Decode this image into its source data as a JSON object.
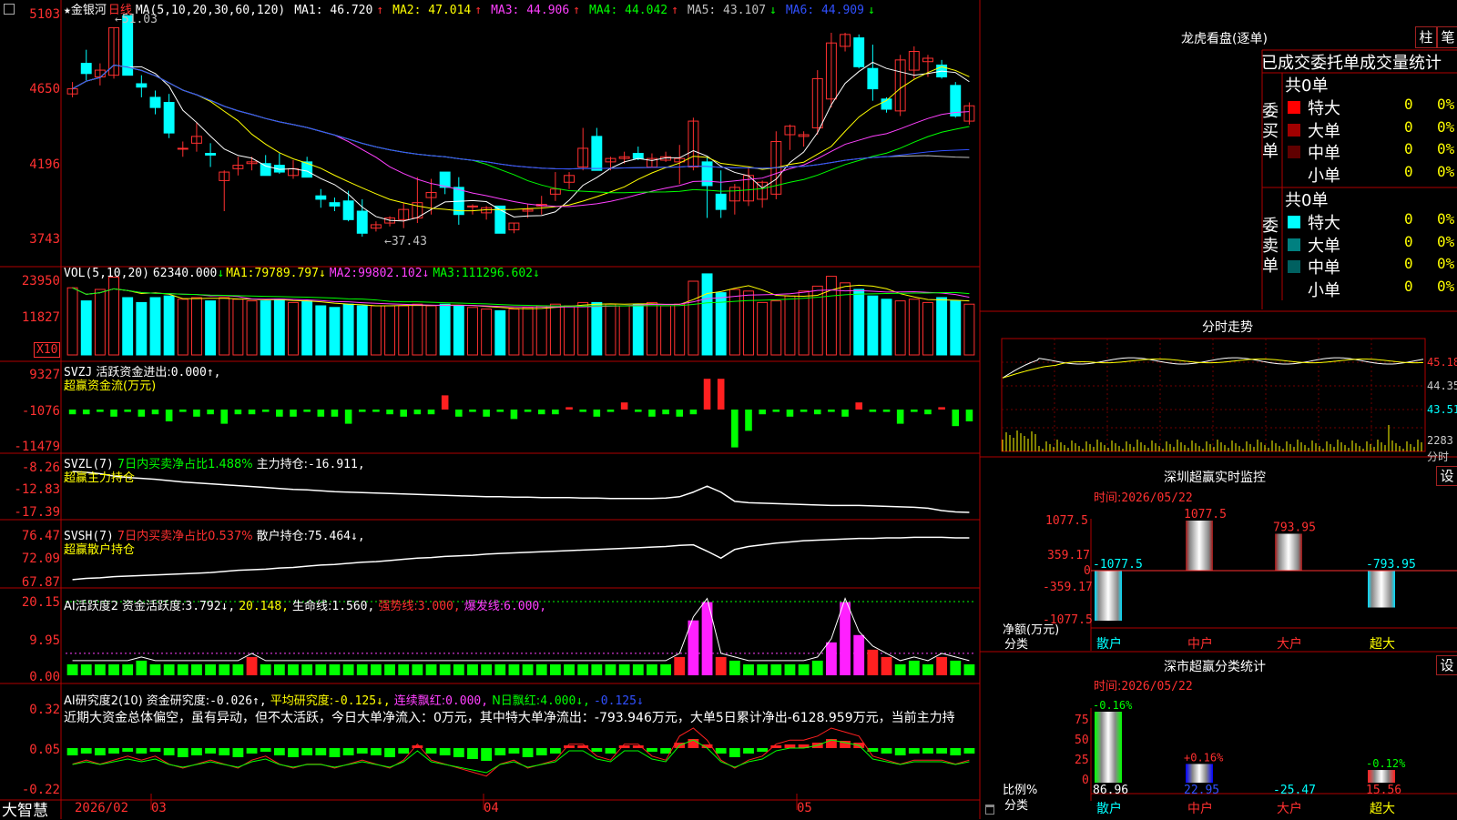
{
  "app": {
    "brand": "大智慧",
    "corner_icon": "restore-icon"
  },
  "main_chart": {
    "star_symbol": "★",
    "stock_name": "金银河",
    "period": "日线",
    "ma_params": "MA(5,10,20,30,60,120)",
    "ma": [
      {
        "label": "MA1:",
        "value": "46.720",
        "arrow": "↑",
        "color": "#ffffff"
      },
      {
        "label": "MA2:",
        "value": "47.014",
        "arrow": "↑",
        "color": "#ffff00"
      },
      {
        "label": "MA3:",
        "value": "44.906",
        "arrow": "↑",
        "color": "#ff40ff"
      },
      {
        "label": "MA4:",
        "value": "44.042",
        "arrow": "↑",
        "color": "#00ff00"
      },
      {
        "label": "MA5:",
        "value": "43.107",
        "arrow": "↓",
        "color": "#c0c0c0"
      },
      {
        "label": "MA6:",
        "value": "44.909",
        "arrow": "↓",
        "color": "#3050ff"
      }
    ],
    "y_ticks": [
      "5103",
      "4650",
      "4196",
      "3743"
    ],
    "high_marker": "←51.03",
    "low_marker": "←37.43",
    "price_range": [
      36.5,
      51.5
    ],
    "candles": [
      [
        46.4,
        47.1,
        46.2,
        46.7
      ],
      [
        48.2,
        49.0,
        47.2,
        47.6
      ],
      [
        47.4,
        48.2,
        46.9,
        47.8
      ],
      [
        47.5,
        50.3,
        47.3,
        50.3
      ],
      [
        51.0,
        51.03,
        47.5,
        47.5
      ],
      [
        47.0,
        47.5,
        46.2,
        46.8
      ],
      [
        46.2,
        46.6,
        45.2,
        45.6
      ],
      [
        45.9,
        46.4,
        43.8,
        44.1
      ],
      [
        43.2,
        43.6,
        42.7,
        43.2
      ],
      [
        43.5,
        44.7,
        43.0,
        43.9
      ],
      [
        42.9,
        43.5,
        42.1,
        42.8
      ],
      [
        41.3,
        41.9,
        39.5,
        41.8
      ],
      [
        42.0,
        42.7,
        41.6,
        42.2
      ],
      [
        42.3,
        42.7,
        41.9,
        42.4
      ],
      [
        42.3,
        42.8,
        41.9,
        41.6
      ],
      [
        42.2,
        42.9,
        41.7,
        41.8
      ],
      [
        41.6,
        42.5,
        41.4,
        42.0
      ],
      [
        42.4,
        42.7,
        41.5,
        41.5
      ],
      [
        40.4,
        40.8,
        39.7,
        40.2
      ],
      [
        40.0,
        40.3,
        39.5,
        39.8
      ],
      [
        40.1,
        40.7,
        38.9,
        39.0
      ],
      [
        39.5,
        40.2,
        38.0,
        38.2
      ],
      [
        38.5,
        38.9,
        38.3,
        38.7
      ],
      [
        38.8,
        39.2,
        38.6,
        39.1
      ],
      [
        39.0,
        40.0,
        38.5,
        39.6
      ],
      [
        39.1,
        41.5,
        38.8,
        40.0
      ],
      [
        40.3,
        41.4,
        39.3,
        40.6
      ],
      [
        41.8,
        41.8,
        40.5,
        40.9
      ],
      [
        40.9,
        41.5,
        38.7,
        39.3
      ],
      [
        39.8,
        39.9,
        39.3,
        39.8
      ],
      [
        39.4,
        39.8,
        39.0,
        39.7
      ],
      [
        39.8,
        39.8,
        38.2,
        38.2
      ],
      [
        38.4,
        38.8,
        38.2,
        38.8
      ],
      [
        39.5,
        39.9,
        39.1,
        39.6
      ],
      [
        39.8,
        40.4,
        39.3,
        39.9
      ],
      [
        40.5,
        41.8,
        40.1,
        40.8
      ],
      [
        41.2,
        41.8,
        40.8,
        41.6
      ],
      [
        42.1,
        44.4,
        41.9,
        43.2
      ],
      [
        43.9,
        44.4,
        41.9,
        41.9
      ],
      [
        42.4,
        42.7,
        41.9,
        42.6
      ],
      [
        42.6,
        43.0,
        42.3,
        42.7
      ],
      [
        42.9,
        43.3,
        42.5,
        42.6
      ],
      [
        42.1,
        42.9,
        42.1,
        42.6
      ],
      [
        42.5,
        43.0,
        42.4,
        42.7
      ],
      [
        42.4,
        43.4,
        41.1,
        42.6
      ],
      [
        42.1,
        45.0,
        41.9,
        44.8
      ],
      [
        42.4,
        42.7,
        39.1,
        41.0
      ],
      [
        40.5,
        41.9,
        39.1,
        39.6
      ],
      [
        40.1,
        41.1,
        39.3,
        40.9
      ],
      [
        40.1,
        42.1,
        39.8,
        41.6
      ],
      [
        40.2,
        41.3,
        39.7,
        41.2
      ],
      [
        40.5,
        44.2,
        40.2,
        43.6
      ],
      [
        44.0,
        44.6,
        43.1,
        44.5
      ],
      [
        43.9,
        44.2,
        43.3,
        44.0
      ],
      [
        44.4,
        47.8,
        44.0,
        47.3
      ],
      [
        46.1,
        50.0,
        45.6,
        49.4
      ],
      [
        49.2,
        50.0,
        48.9,
        49.9
      ],
      [
        49.7,
        49.9,
        47.9,
        48.0
      ],
      [
        47.9,
        49.3,
        46.0,
        46.7
      ],
      [
        46.1,
        46.2,
        45.3,
        45.5
      ],
      [
        45.4,
        48.7,
        45.1,
        48.4
      ],
      [
        47.8,
        49.2,
        47.3,
        48.9
      ],
      [
        48.3,
        48.7,
        47.4,
        48.5
      ],
      [
        48.1,
        48.4,
        47.3,
        47.4
      ],
      [
        46.9,
        47.1,
        45.0,
        45.1
      ],
      [
        44.8,
        45.9,
        44.6,
        45.7
      ]
    ]
  },
  "vol_panel": {
    "params": "VOL(5,10,20)",
    "value": "62340.000",
    "value_arrow": "↓",
    "ma1_label": "MA1:",
    "ma1": "79789.797↓",
    "ma2_label": "MA2:",
    "ma2": "99802.102↓",
    "ma3_label": "MA3:",
    "ma3": "111296.602↓",
    "y_ticks": [
      "23950",
      "11827"
    ],
    "unit_badge": "X10",
    "values": [
      82,
      66,
      80,
      95,
      70,
      64,
      70,
      72,
      68,
      70,
      66,
      70,
      68,
      66,
      66,
      68,
      64,
      66,
      60,
      58,
      62,
      60,
      60,
      60,
      60,
      62,
      60,
      62,
      60,
      58,
      56,
      54,
      56,
      58,
      60,
      62,
      60,
      64,
      64,
      62,
      60,
      62,
      64,
      60,
      62,
      90,
      99,
      76,
      80,
      78,
      64,
      66,
      72,
      78,
      84,
      96,
      88,
      80,
      72,
      68,
      66,
      68,
      64,
      70,
      66,
      62
    ]
  },
  "svzj_panel": {
    "name": "SVZJ",
    "label1": "活跃资金进出:",
    "value1": "0.000↑,",
    "label2": "超赢资金流(万元)",
    "y_ticks": [
      "9327",
      "-1076",
      "-11479"
    ],
    "values": [
      -2,
      -2,
      -1,
      -3,
      -1,
      -3,
      -2,
      -5,
      -1,
      -3,
      -2,
      -6,
      -2,
      -2,
      -1,
      -3,
      -3,
      -1,
      -3,
      -3,
      -6,
      -1,
      -1,
      -2,
      -3,
      -2,
      -2,
      6,
      -3,
      -1,
      -3,
      -1,
      -4,
      -1,
      -2,
      -2,
      1,
      -1,
      -3,
      -1,
      3,
      -1,
      -3,
      -2,
      -3,
      -2,
      13,
      13,
      -16,
      -9,
      -2,
      -1,
      -3,
      -1,
      -2,
      -1,
      -3,
      3,
      -1,
      -1,
      -6,
      -1,
      -2,
      1,
      -7,
      -5
    ]
  },
  "svzl_panel": {
    "name": "SVZL",
    "period_label": "(7)",
    "label1": "7日内买卖净占比1.488%",
    "label2": "主力持仓:",
    "value2": "-16.911,",
    "label3": "超赢主力持仓",
    "y_ticks": [
      "-8.26",
      "-12.83",
      "-17.39"
    ],
    "values": [
      -8.0,
      -8.2,
      -8.5,
      -9.0,
      -9.3,
      -9.5,
      -9.7,
      -10.0,
      -10.3,
      -10.5,
      -10.7,
      -10.9,
      -11.1,
      -11.3,
      -11.5,
      -11.7,
      -11.9,
      -12.0,
      -12.2,
      -12.4,
      -12.5,
      -12.6,
      -12.7,
      -12.8,
      -12.9,
      -13.0,
      -13.1,
      -13.2,
      -13.3,
      -13.4,
      -13.5,
      -13.5,
      -13.6,
      -13.6,
      -13.7,
      -13.7,
      -13.7,
      -13.8,
      -13.8,
      -13.9,
      -13.9,
      -13.9,
      -13.9,
      -13.8,
      -13.5,
      -12.5,
      -11.2,
      -12.5,
      -14.5,
      -14.8,
      -14.9,
      -15.0,
      -15.1,
      -15.2,
      -15.3,
      -15.4,
      -15.4,
      -15.4,
      -15.5,
      -15.6,
      -15.7,
      -15.8,
      -16.0,
      -16.5,
      -16.8,
      -16.9
    ]
  },
  "svsh_panel": {
    "name": "SVSH",
    "period_label": "(7)",
    "label1": "7日内买卖净占比0.537%",
    "label2": "散户持仓:",
    "value2": "75.464↓,",
    "label3": "超赢散户持仓",
    "y_ticks": [
      "76.47",
      "72.09",
      "67.87"
    ],
    "values": [
      68.3,
      68.5,
      68.6,
      68.8,
      68.9,
      69.0,
      69.1,
      69.2,
      69.3,
      69.4,
      69.5,
      69.7,
      69.9,
      70.0,
      70.1,
      70.3,
      70.4,
      70.6,
      70.8,
      70.9,
      71.1,
      71.3,
      71.4,
      71.6,
      71.8,
      72.0,
      72.1,
      72.3,
      72.4,
      72.5,
      72.7,
      72.8,
      72.9,
      73.0,
      73.1,
      73.2,
      73.3,
      73.4,
      73.5,
      73.6,
      73.7,
      73.8,
      73.9,
      74.0,
      74.2,
      74.3,
      73.2,
      72.0,
      73.5,
      74.0,
      74.3,
      74.6,
      74.8,
      75.0,
      75.1,
      75.2,
      75.3,
      75.4,
      75.4,
      75.5,
      75.5,
      75.6,
      75.6,
      75.6,
      75.5,
      75.5
    ]
  },
  "ai_active_panel": {
    "name": "AI活跃度2",
    "label1": "资金活跃度:",
    "value1": "3.792↓,",
    "value2": "20.148,",
    "label3": "生命线:",
    "value3": "1.560,",
    "label4": "强势线:",
    "value4": "3.000,",
    "label5": "爆发线:",
    "value5": "6.000,",
    "y_ticks": [
      "20.15",
      "9.95",
      "0.00"
    ],
    "values": [
      3,
      3,
      3,
      3,
      3,
      4,
      3,
      3,
      3,
      3,
      3,
      3,
      3,
      5,
      3,
      3,
      3,
      3,
      3,
      3,
      3,
      3,
      3,
      3,
      3,
      3,
      3,
      3,
      3,
      3,
      3,
      3,
      3,
      3,
      3,
      3,
      3,
      3,
      3,
      3,
      3,
      3,
      3,
      3,
      5,
      15,
      20,
      5,
      4,
      3,
      3,
      3,
      3,
      3,
      4,
      9,
      20,
      11,
      7,
      5,
      3,
      4,
      3,
      5,
      4,
      3
    ]
  },
  "ai_research_panel": {
    "name": "AI研究度2(10)",
    "label1": "资金研究度:",
    "value1": "-0.026↑,",
    "label2": "平均研究度:",
    "value2": "-0.125↓,",
    "label3": "连续飘红:",
    "value3": "0.000,",
    "label4": "N日飘红:",
    "value4": "4.000↓,",
    "value5": "-0.125↓",
    "commentary": "近期大资金总体偏空，虽有异动，但不太活跃，今日大单净流入：0万元，其中特大单净流出：-793.946万元，大单5日累计净出-6128.959万元，当前主力持",
    "y_ticks": [
      "0.32",
      "0.05",
      "-0.22"
    ],
    "values": [
      -0.04,
      -0.03,
      -0.04,
      -0.03,
      -0.02,
      -0.03,
      -0.02,
      -0.04,
      -0.05,
      -0.04,
      -0.03,
      -0.04,
      -0.05,
      -0.03,
      -0.02,
      -0.04,
      -0.05,
      -0.04,
      -0.04,
      -0.05,
      -0.04,
      -0.03,
      -0.04,
      -0.05,
      -0.03,
      0.01,
      -0.03,
      -0.04,
      -0.05,
      -0.06,
      -0.07,
      -0.04,
      -0.03,
      -0.05,
      -0.04,
      -0.03,
      0.01,
      0.01,
      -0.02,
      -0.03,
      0.01,
      0.01,
      -0.02,
      -0.03,
      0.03,
      0.05,
      0.02,
      -0.03,
      -0.05,
      -0.03,
      -0.02,
      0.01,
      0.02,
      0.02,
      0.03,
      0.05,
      0.04,
      0.03,
      -0.02,
      -0.03,
      -0.04,
      -0.03,
      -0.03,
      -0.03,
      -0.04,
      -0.03
    ]
  },
  "x_axis": {
    "labels": [
      "2026/02",
      "03",
      "04",
      "05"
    ]
  },
  "right_panel": {
    "title": "龙虎看盘(逐单)",
    "btn_zhu": "柱",
    "btn_bi": "笔",
    "tabs": [
      "已成交",
      "委托单",
      "成交量统计"
    ],
    "buy": {
      "title": "委买单",
      "total": "共0单",
      "rows": [
        {
          "label": "特大",
          "count": "0",
          "pct": "0%",
          "color": "#ff0000"
        },
        {
          "label": "大单",
          "count": "0",
          "pct": "0%",
          "color": "#a00000"
        },
        {
          "label": "中单",
          "count": "0",
          "pct": "0%",
          "color": "#600000"
        },
        {
          "label": "小单",
          "count": "0",
          "pct": "0%",
          "color": "#000000"
        }
      ]
    },
    "sell": {
      "title": "委卖单",
      "total": "共0单",
      "rows": [
        {
          "label": "特大",
          "count": "0",
          "pct": "0%",
          "color": "#00ffff"
        },
        {
          "label": "大单",
          "count": "0",
          "pct": "0%",
          "color": "#008080"
        },
        {
          "label": "中单",
          "count": "0",
          "pct": "0%",
          "color": "#006060"
        },
        {
          "label": "小单",
          "count": "0",
          "pct": "0%",
          "color": "#000000"
        }
      ]
    },
    "intraday": {
      "title": "分时走势",
      "y_ticks": [
        "45.18",
        "44.35",
        "43.51",
        "2283",
        "分时"
      ]
    },
    "sz_monitor": {
      "title": "深圳超赢实时监控",
      "btn": "设",
      "time_label": "时间:",
      "time_value": "2026/05/22",
      "y_ticks": [
        "1077.5",
        "359.17",
        "0",
        "-359.17",
        "-1077.5"
      ],
      "axis_label1": "净额(万元)",
      "axis_label2": "分类",
      "categories": [
        "散户",
        "中户",
        "大户",
        "超大"
      ],
      "bars": [
        {
          "value": -1077.5,
          "label": "-1077.5"
        },
        {
          "value": 1077.5,
          "label": "1077.5"
        },
        {
          "value": 793.95,
          "label": "793.95"
        },
        {
          "value": -793.95,
          "label": "-793.95"
        }
      ]
    },
    "sz_classify": {
      "title": "深市超赢分类统计",
      "btn": "设",
      "time_label": "时间:",
      "time_value": "2026/05/22",
      "y_ticks": [
        "75",
        "50",
        "25",
        "0"
      ],
      "axis_label1": "比例%",
      "axis_label2": "分类",
      "categories": [
        "散户",
        "中户",
        "大户",
        "超大"
      ],
      "bars": [
        {
          "value": 86.96,
          "label": "86.96",
          "top_label": "-0.16%"
        },
        {
          "value": 22.95,
          "label": "22.95",
          "top_label": "+0.16%"
        },
        {
          "value": -25.47,
          "label": "-25.47",
          "top_label": ""
        },
        {
          "value": 15.56,
          "label": "15.56",
          "top_label": "-0.12%"
        }
      ]
    }
  }
}
